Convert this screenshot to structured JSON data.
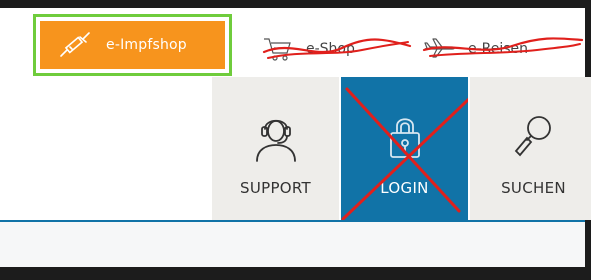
{
  "header": {
    "shop_link": {
      "label": "e-Impfshop",
      "icon": "syringe-icon",
      "color": "#f7941d",
      "highlight_color": "#6fcc3c"
    },
    "crossed_links": [
      {
        "label": "e-Shop",
        "icon": "cart-icon"
      },
      {
        "label": "e-Reisen",
        "icon": "airplane-icon"
      }
    ],
    "strike_color": "#e0201c"
  },
  "nav": {
    "items": [
      {
        "label": "SUPPORT",
        "icon": "headset-icon",
        "active": false
      },
      {
        "label": "LOGIN",
        "icon": "lock-icon",
        "active": true,
        "crossed_out": true
      },
      {
        "label": "SUCHEN",
        "icon": "magnifier-icon",
        "active": false
      }
    ],
    "active_color": "#1173a7"
  }
}
